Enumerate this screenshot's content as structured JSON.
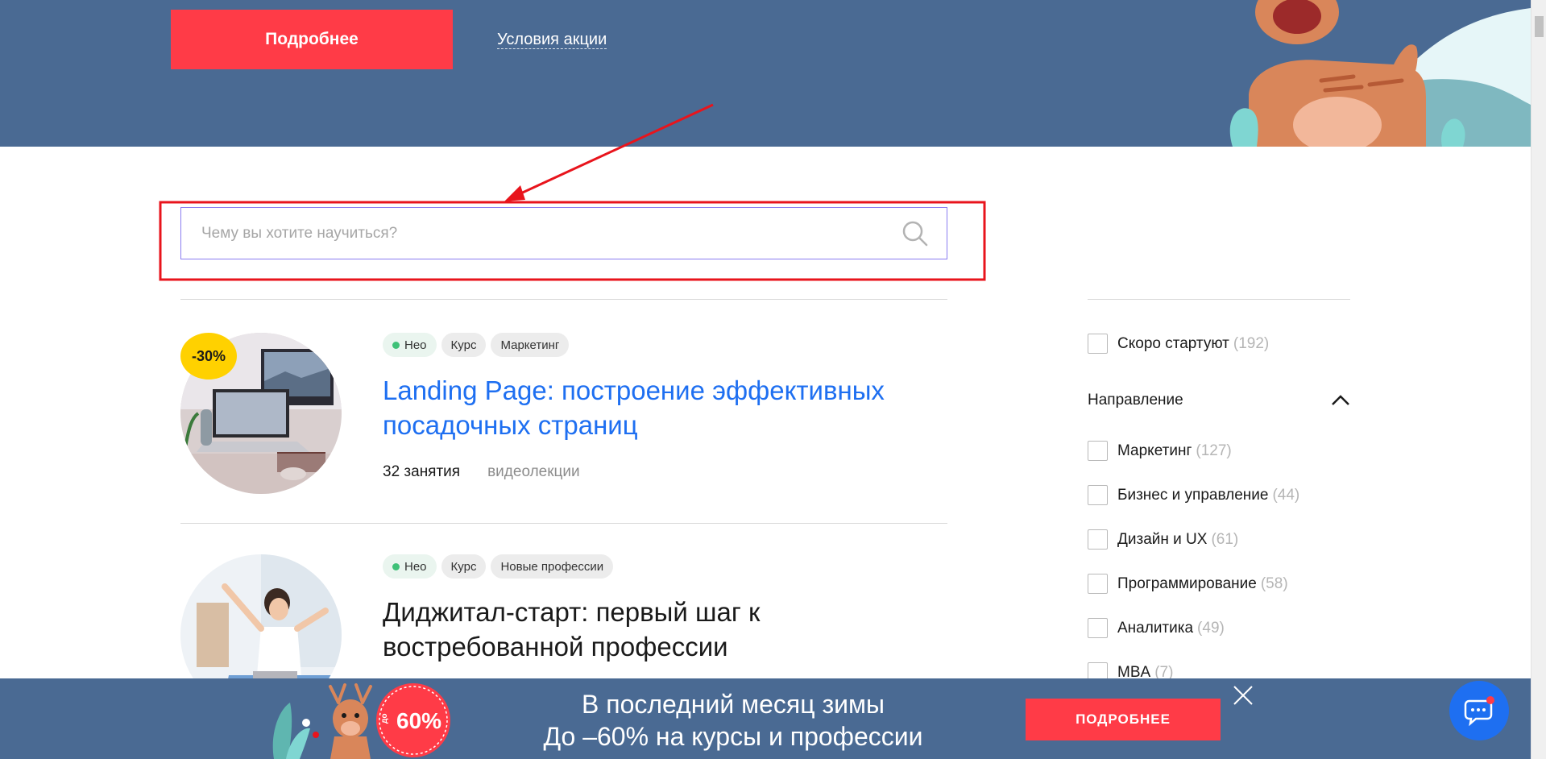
{
  "top_banner": {
    "more_label": "Подробнее",
    "terms_label": "Условия акции"
  },
  "search": {
    "placeholder": "Чему вы хотите научиться?"
  },
  "courses": [
    {
      "discount": "-30%",
      "tags": [
        "Нео",
        "Курс",
        "Маркетинг"
      ],
      "title": "Landing Page: построение эффективных посадочных страниц",
      "lessons": "32 занятия",
      "format": "видеолекции"
    },
    {
      "tags": [
        "Нео",
        "Курс",
        "Новые профессии"
      ],
      "title": "Диджитал-старт: первый шаг к востребованной профессии"
    }
  ],
  "filters": {
    "starting_soon": {
      "label": "Скоро стартуют",
      "count": "(192)"
    },
    "direction_heading": "Направление",
    "directions": [
      {
        "label": "Маркетинг",
        "count": "(127)"
      },
      {
        "label": "Бизнес и управление",
        "count": "(44)"
      },
      {
        "label": "Дизайн и UX",
        "count": "(61)"
      },
      {
        "label": "Программирование",
        "count": "(58)"
      },
      {
        "label": "Аналитика",
        "count": "(49)"
      },
      {
        "label": "MBA",
        "count": "(7)"
      }
    ]
  },
  "bottom_banner": {
    "line1": "В последний месяц зимы",
    "line2": "До –60% на курсы и профессии",
    "button_label": "ПОДРОБНЕЕ",
    "badge_prefix": "до",
    "badge_value": "60%"
  },
  "colors": {
    "banner_bg": "#4a6a93",
    "accent_red": "#ff3b47",
    "link_blue": "#1e6ff1",
    "discount_yellow": "#ffd100",
    "annotation_red": "#e8141c"
  }
}
